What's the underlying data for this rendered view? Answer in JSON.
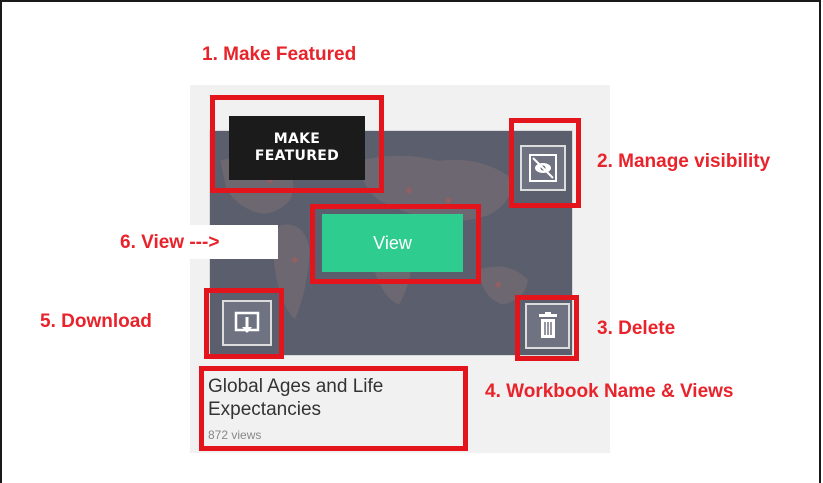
{
  "annotations": {
    "make_featured": "1. Make Featured",
    "manage_visibility": "2. Manage visibility",
    "delete": "3. Delete",
    "workbook_name_views": "4. Workbook Name & Views",
    "download": "5. Download",
    "view": "6. View --->"
  },
  "card": {
    "make_featured_line1": "MAKE",
    "make_featured_line2": "FEATURED",
    "view_label": "View",
    "workbook_title": "Global Ages and Life Expectancies",
    "views_count": "872 views",
    "visibility_icon": "eye-slash-icon",
    "download_icon": "download-icon",
    "delete_icon": "trash-icon"
  },
  "colors": {
    "annotation_red": "#e8232b",
    "highlight_box": "#e3141c",
    "view_button": "#2ecc8f",
    "thumbnail_overlay": "#5b5e6c"
  }
}
